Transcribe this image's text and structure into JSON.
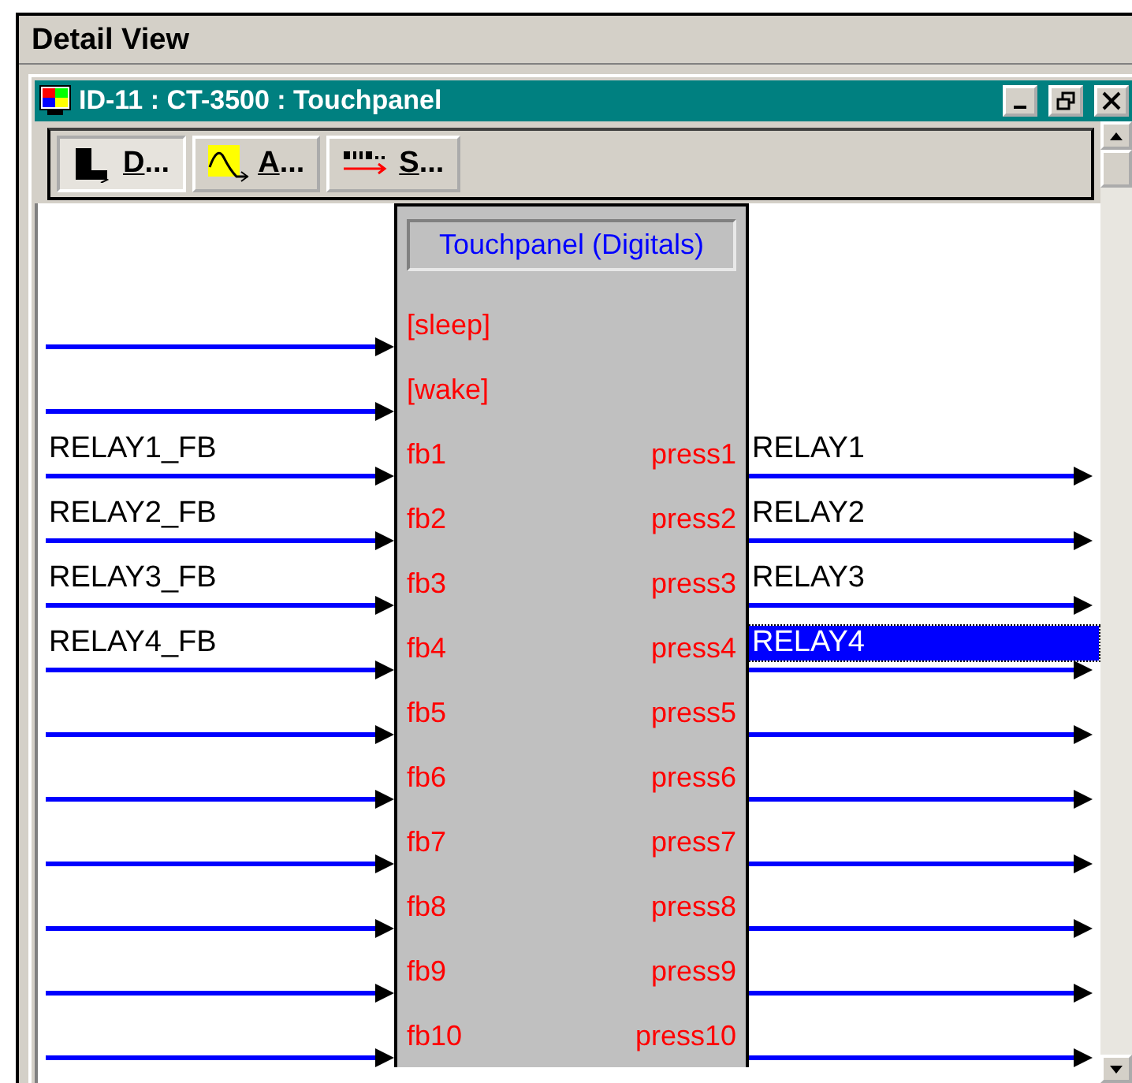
{
  "panel": {
    "title": "Detail View"
  },
  "window": {
    "title": "ID-11 : CT-3500 : Touchpanel"
  },
  "toolbar": [
    {
      "label": "D...",
      "kind": "digital",
      "selected": true
    },
    {
      "label": "A...",
      "kind": "analog",
      "selected": false
    },
    {
      "label": "S...",
      "kind": "serial",
      "selected": false
    }
  ],
  "block": {
    "title": "Touchpanel (Digitals)",
    "rows": [
      {
        "input": "[sleep]"
      },
      {
        "input": "[wake]"
      },
      {
        "input": "fb1",
        "input_signal": "RELAY1_FB",
        "output": "press1",
        "output_signal": "RELAY1",
        "selected": false
      },
      {
        "input": "fb2",
        "input_signal": "RELAY2_FB",
        "output": "press2",
        "output_signal": "RELAY2",
        "selected": false
      },
      {
        "input": "fb3",
        "input_signal": "RELAY3_FB",
        "output": "press3",
        "output_signal": "RELAY3",
        "selected": false
      },
      {
        "input": "fb4",
        "input_signal": "RELAY4_FB",
        "output": "press4",
        "output_signal": "RELAY4",
        "selected": true
      },
      {
        "input": "fb5",
        "output": "press5",
        "selected": false
      },
      {
        "input": "fb6",
        "output": "press6",
        "selected": false
      },
      {
        "input": "fb7",
        "output": "press7",
        "selected": false
      },
      {
        "input": "fb8",
        "output": "press8",
        "selected": false
      },
      {
        "input": "fb9",
        "output": "press9",
        "selected": false
      },
      {
        "input": "fb10",
        "output": "press10",
        "selected": false
      }
    ]
  }
}
